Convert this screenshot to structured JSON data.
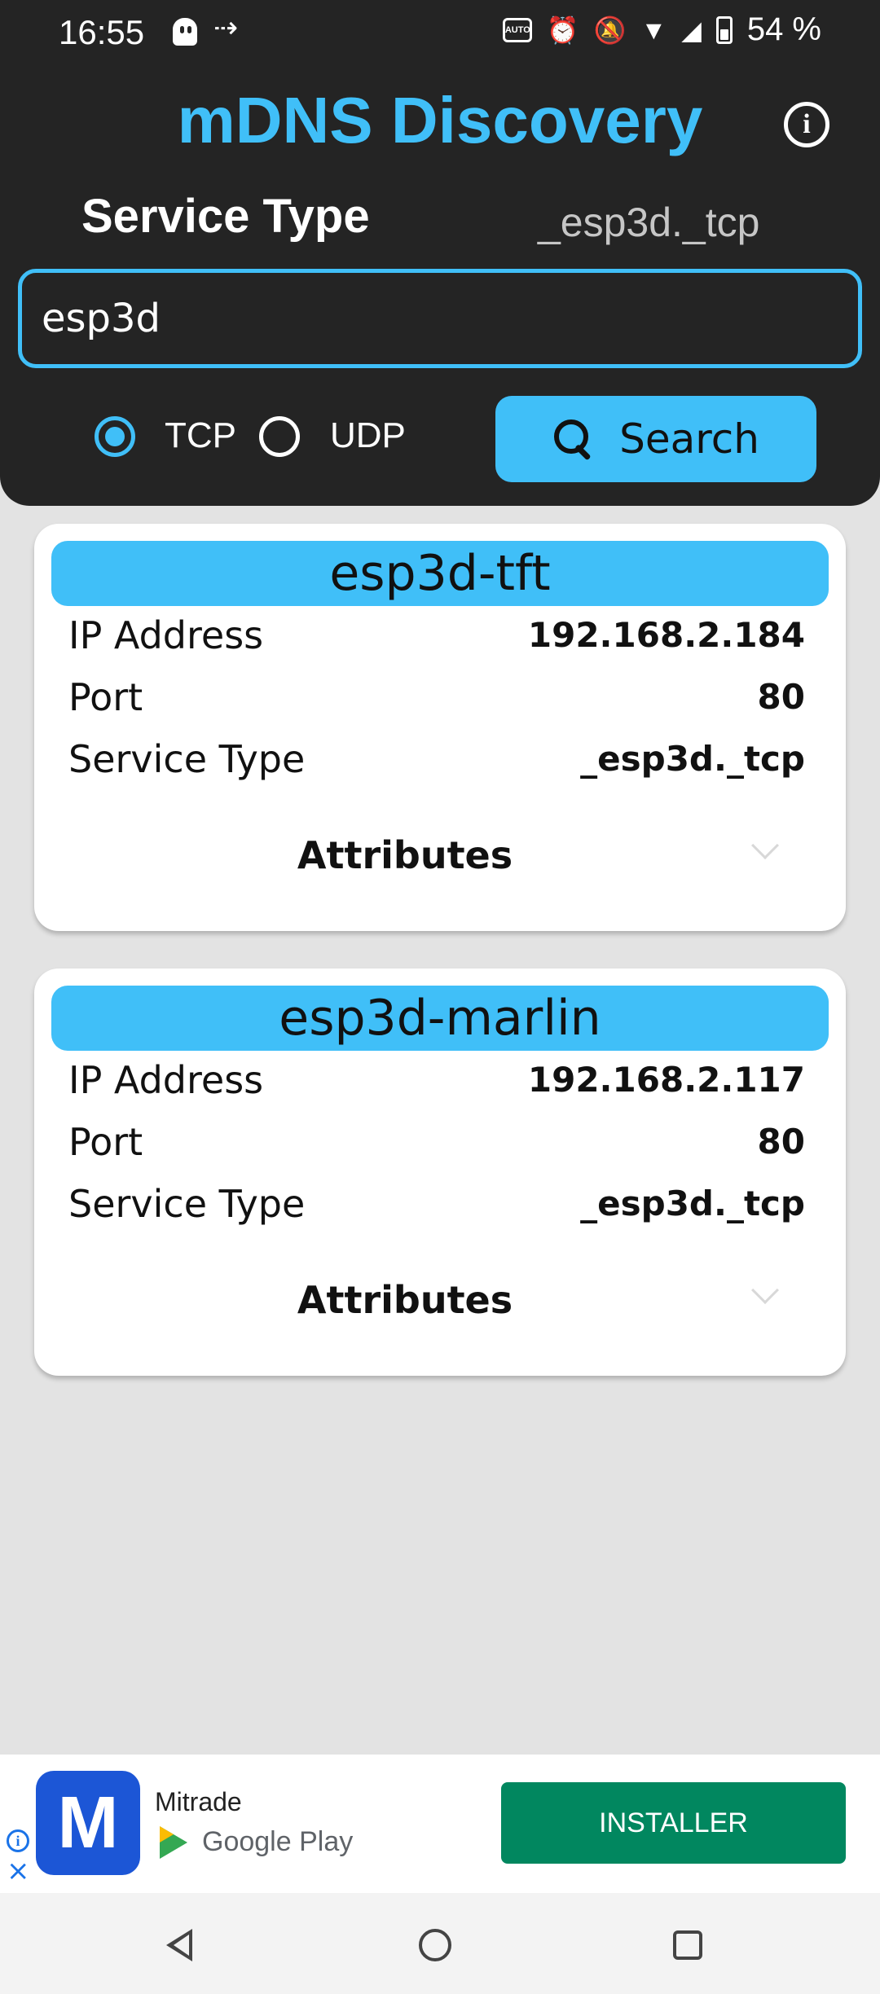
{
  "status_bar": {
    "time": "16:55",
    "icons": [
      "ghost-icon",
      "arrows-icon",
      "auto-hz-icon",
      "alarm-icon",
      "bell-off-icon",
      "wifi-icon",
      "signal-icon",
      "battery-icon"
    ],
    "auto_badge": "AUTO",
    "battery_percent": "54 %"
  },
  "header": {
    "title": "mDNS Discovery",
    "info_icon": "i",
    "service_type_label": "Service Type",
    "service_type_value": "_esp3d._tcp",
    "search_input_value": "esp3d",
    "protocol_options": [
      {
        "label": "TCP",
        "selected": true
      },
      {
        "label": "UDP",
        "selected": false
      }
    ],
    "search_button_label": "Search"
  },
  "services": [
    {
      "name": "esp3d-tft",
      "rows": [
        {
          "label": "IP Address",
          "value": "192.168.2.184"
        },
        {
          "label": "Port",
          "value": "80"
        },
        {
          "label": "Service Type",
          "value": "_esp3d._tcp"
        }
      ],
      "attributes_label": "Attributes"
    },
    {
      "name": "esp3d-marlin",
      "rows": [
        {
          "label": "IP Address",
          "value": "192.168.2.117"
        },
        {
          "label": "Port",
          "value": "80"
        },
        {
          "label": "Service Type",
          "value": "_esp3d._tcp"
        }
      ],
      "attributes_label": "Attributes"
    }
  ],
  "ad": {
    "logo_glyph": "M",
    "advertiser": "Mitrade",
    "store": "Google Play",
    "cta": "INSTALLER",
    "info_glyph": "i",
    "close_glyph": "×"
  },
  "colors": {
    "accent": "#40bff8",
    "header_bg": "#242424",
    "page_bg": "#e3e3e3",
    "card_bg": "#ffffff",
    "cta_green": "#01875f"
  }
}
